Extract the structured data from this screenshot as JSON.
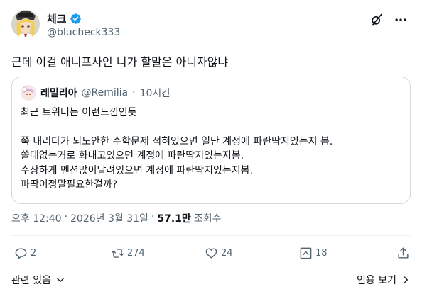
{
  "author": {
    "display_name": "체크",
    "handle": "@blucheck333"
  },
  "tweet": {
    "text": "근데 이걸 애니프사인 니가 할말은 아니자않냐"
  },
  "quote": {
    "display_name": "레밀리아",
    "handle": "@Remilia",
    "separator": "·",
    "time": "10시간",
    "lines": [
      "최근 트위터는 이런느낌인듯",
      "",
      "쭉 내리다가 되도안한 수학문제 적혀있으면 일단 계정에 파란딱지있는지 봄.",
      "쓸데없는거로 화내고있으면 계정에 파란딱지있는지봄.",
      "수상하게 멘션많이달려있으면 계정에 파란딱지있는지봄.",
      "파딱이정말필요한걸까?"
    ]
  },
  "meta": {
    "time": "오후 12:40",
    "sep1": "·",
    "date": "2026년 3월 31일",
    "sep2": "·",
    "views": "57.1만",
    "views_label": "조회수"
  },
  "actions": {
    "reply_count": "2",
    "retweet_count": "274",
    "like_count": "24",
    "bookmark_count": "18"
  },
  "footer": {
    "related": "관련 있음",
    "quotes": "인용 보기"
  },
  "icons": {
    "verified": "verified-badge-icon",
    "grok": "grok-icon",
    "more": "more-icon",
    "reply": "reply-icon",
    "retweet": "retweet-icon",
    "like": "heart-icon",
    "views": "bar-chart-icon",
    "share": "share-icon"
  },
  "colors": {
    "verified_blue": "#1d9bf0",
    "secondary_text": "#536471",
    "primary_text": "#0f1419",
    "border": "#cfd9de"
  }
}
